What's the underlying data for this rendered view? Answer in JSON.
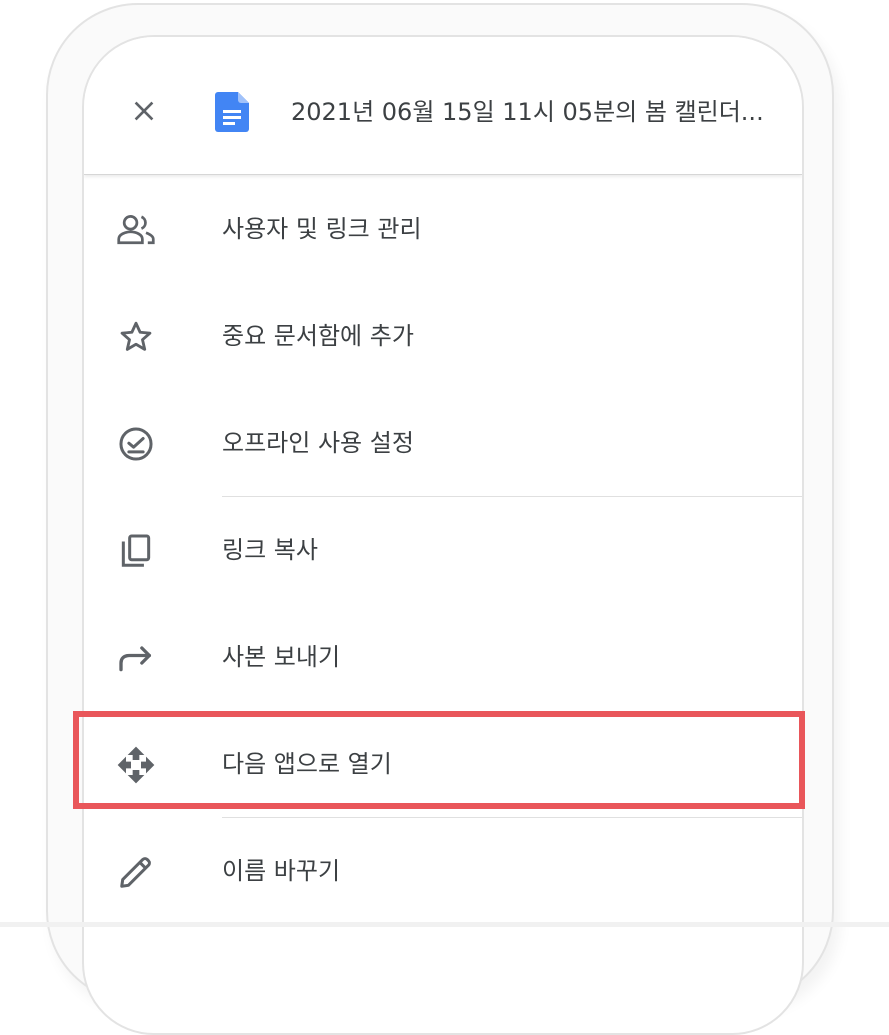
{
  "header": {
    "title": "2021년 06월 15일 11시 05분의 봄 캘린더..."
  },
  "menu": {
    "items": [
      {
        "label": "사용자 및 링크 관리",
        "icon": "people-icon"
      },
      {
        "label": "중요 문서함에 추가",
        "icon": "star-icon"
      },
      {
        "label": "오프라인 사용 설정",
        "icon": "offline-check-icon"
      },
      {
        "label": "링크 복사",
        "icon": "copy-icon"
      },
      {
        "label": "사본 보내기",
        "icon": "forward-arrow-icon"
      },
      {
        "label": "다음 앱으로 열기",
        "icon": "open-with-icon"
      },
      {
        "label": "이름 바꾸기",
        "icon": "pencil-icon"
      }
    ],
    "highlighted_index": 5
  },
  "colors": {
    "highlight": "#e9565a",
    "doc_icon": "#4285f4",
    "text": "#3c4043",
    "icon": "#5f6368"
  }
}
